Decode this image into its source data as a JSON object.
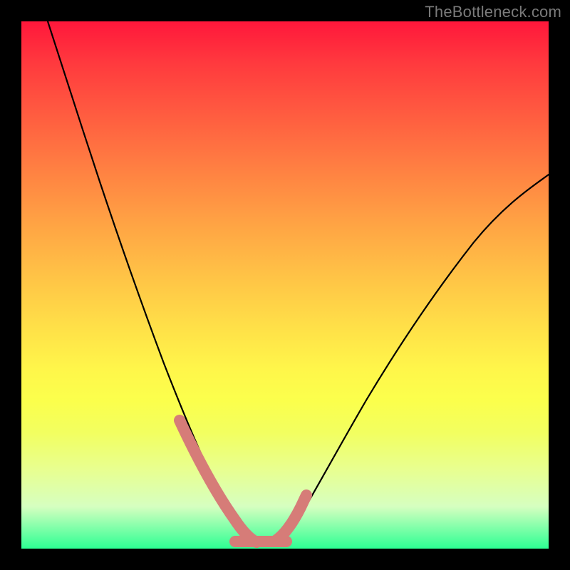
{
  "watermark": "TheBottleneck.com",
  "chart_data": {
    "type": "line",
    "title": "",
    "xlabel": "",
    "ylabel": "",
    "xlim": [
      0,
      100
    ],
    "ylim": [
      0,
      100
    ],
    "gradient_stops": [
      {
        "pos": 0,
        "color": "#ff173b"
      },
      {
        "pos": 8,
        "color": "#ff3a3e"
      },
      {
        "pos": 18,
        "color": "#ff5d40"
      },
      {
        "pos": 28,
        "color": "#ff8042"
      },
      {
        "pos": 38,
        "color": "#ffa244"
      },
      {
        "pos": 48,
        "color": "#ffc246"
      },
      {
        "pos": 58,
        "color": "#ffe048"
      },
      {
        "pos": 66,
        "color": "#fff64a"
      },
      {
        "pos": 72,
        "color": "#fbff4c"
      },
      {
        "pos": 78,
        "color": "#f2ff60"
      },
      {
        "pos": 85,
        "color": "#e8ff90"
      },
      {
        "pos": 92,
        "color": "#d6ffc0"
      },
      {
        "pos": 100,
        "color": "#2dff93"
      }
    ],
    "series": [
      {
        "name": "left-curve",
        "x": [
          5,
          8,
          11,
          14,
          17,
          20,
          23,
          26,
          29,
          32,
          35,
          38,
          40,
          42,
          44
        ],
        "y": [
          100,
          90,
          80,
          71,
          62,
          53,
          45,
          37,
          30,
          23,
          17,
          11,
          7,
          4,
          1
        ]
      },
      {
        "name": "right-curve",
        "x": [
          48,
          50,
          52,
          55,
          58,
          62,
          66,
          70,
          75,
          80,
          86,
          92,
          100
        ],
        "y": [
          1,
          3,
          6,
          10,
          15,
          21,
          27,
          33,
          40,
          47,
          55,
          62,
          71
        ]
      }
    ],
    "highlight_band": {
      "left": {
        "x": [
          29,
          42
        ],
        "y": [
          23,
          4
        ]
      },
      "floor": {
        "x": [
          40,
          50
        ],
        "y": [
          1.5,
          1.5
        ]
      },
      "right": {
        "x": [
          48,
          52
        ],
        "y": [
          2,
          10
        ]
      }
    },
    "colors": {
      "curve": "#000000",
      "highlight": "#d67c78",
      "background_frame": "#000000"
    }
  }
}
